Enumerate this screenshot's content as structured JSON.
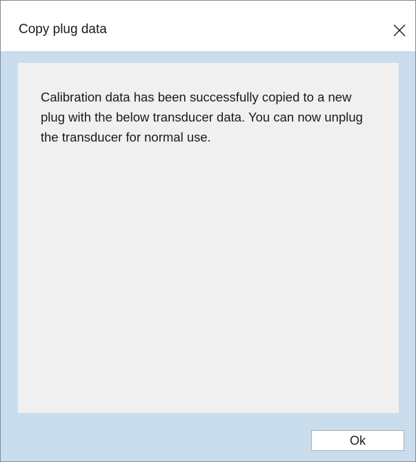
{
  "dialog": {
    "title": "Copy plug data",
    "message": "Calibration data has been successfully copied to a new plug with the below transducer data. You can now unplug the transducer for normal use.",
    "ok_label": "Ok"
  },
  "icons": {
    "close": "close-icon"
  },
  "colors": {
    "title_bar": "#ffffff",
    "frame": "#c9dded",
    "panel": "#f0f0f0",
    "text": "#1a1a1a"
  }
}
